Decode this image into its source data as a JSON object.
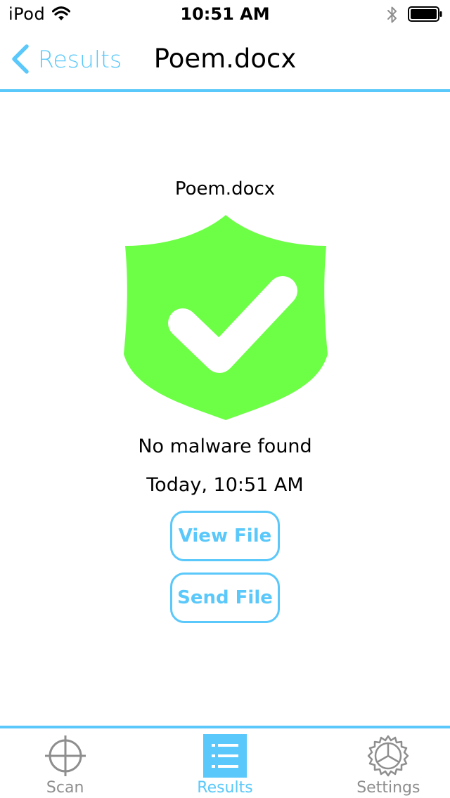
{
  "status_bar": {
    "carrier": "iPod",
    "time": "10:51 AM",
    "icons": [
      "wifi-icon",
      "bluetooth-icon",
      "battery-icon"
    ]
  },
  "nav_bar": {
    "back_label": "Results",
    "title": "Poem.docx"
  },
  "scan_result": {
    "file_name": "Poem.docx",
    "status_icon": "shield-check-icon",
    "status_text": "No malware found",
    "scanned_at": "Today, 10:51 AM"
  },
  "actions": {
    "view_file_label": "View File",
    "send_file_label": "Send File"
  },
  "tab_bar": {
    "tabs": [
      {
        "label": "Scan",
        "icon": "crosshair-icon",
        "active": false
      },
      {
        "label": "Results",
        "icon": "list-icon",
        "active": true
      },
      {
        "label": "Settings",
        "icon": "gear-icon",
        "active": false
      }
    ]
  },
  "colors": {
    "accent": "#5ac8fa",
    "shield_green": "#6cff45",
    "inactive_tab": "#8e8e8e"
  }
}
